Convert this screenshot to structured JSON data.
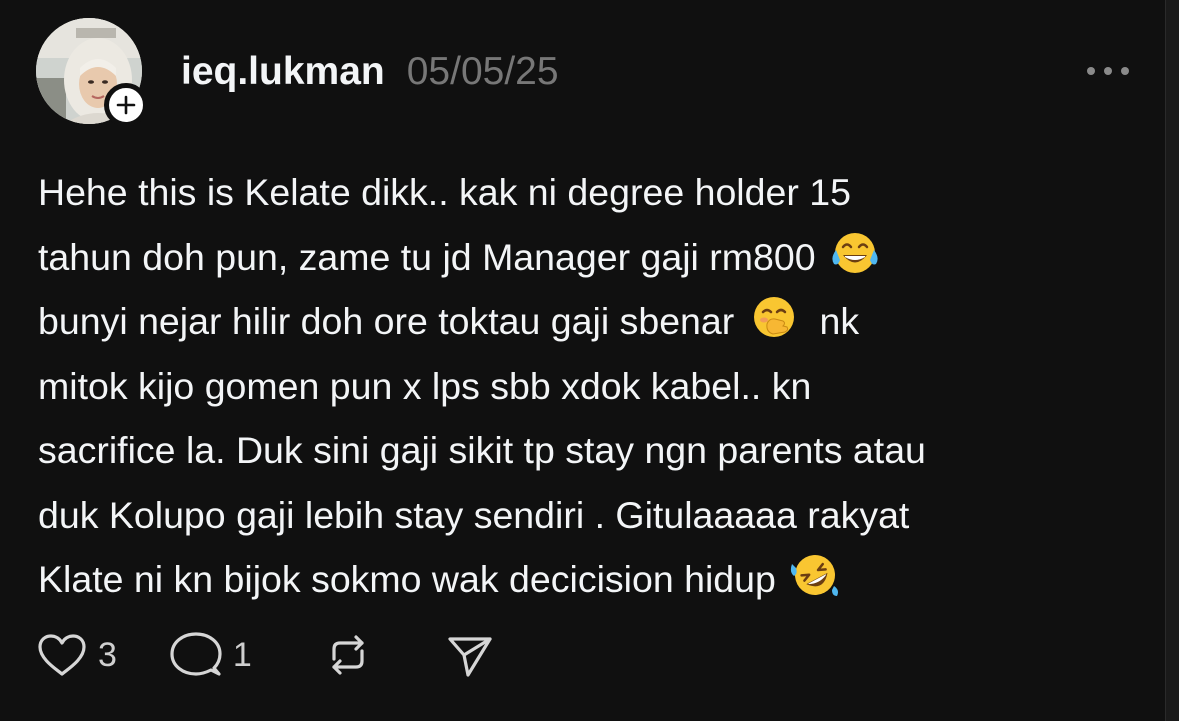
{
  "post": {
    "username": "ieq.lukman",
    "timestamp": "05/05/25",
    "body_lines": [
      "Hehe this is Kelate dikk.. kak ni degree holder 15",
      "tahun doh pun, zame tu jd Manager gaji rm800",
      "bunyi nejar hilir doh ore toktau gaji sbenar",
      "nk",
      "mitok kijo gomen pun x lps sbb xdok kabel.. kn",
      "sacrifice la. Duk sini gaji sikit tp stay ngn parents atau",
      "duk Kolupo gaji lebih stay sendiri . Gitulaaaaa rakyat",
      "Klate ni kn bijok sokmo wak decicision hidup"
    ],
    "emojis": [
      "face-with-tears-of-joy",
      "face-with-hand-over-mouth",
      "rolling-on-the-floor-laughing"
    ]
  },
  "actions": {
    "like_count": "3",
    "reply_count": "1"
  },
  "icons": {
    "more": "more-horizontal-icon",
    "like": "heart-icon",
    "reply": "speech-bubble-icon",
    "repost": "repost-icon",
    "share": "send-icon",
    "follow": "plus-icon"
  },
  "colors": {
    "background": "#101010",
    "text": "#f3f5f7",
    "muted": "#777777"
  }
}
